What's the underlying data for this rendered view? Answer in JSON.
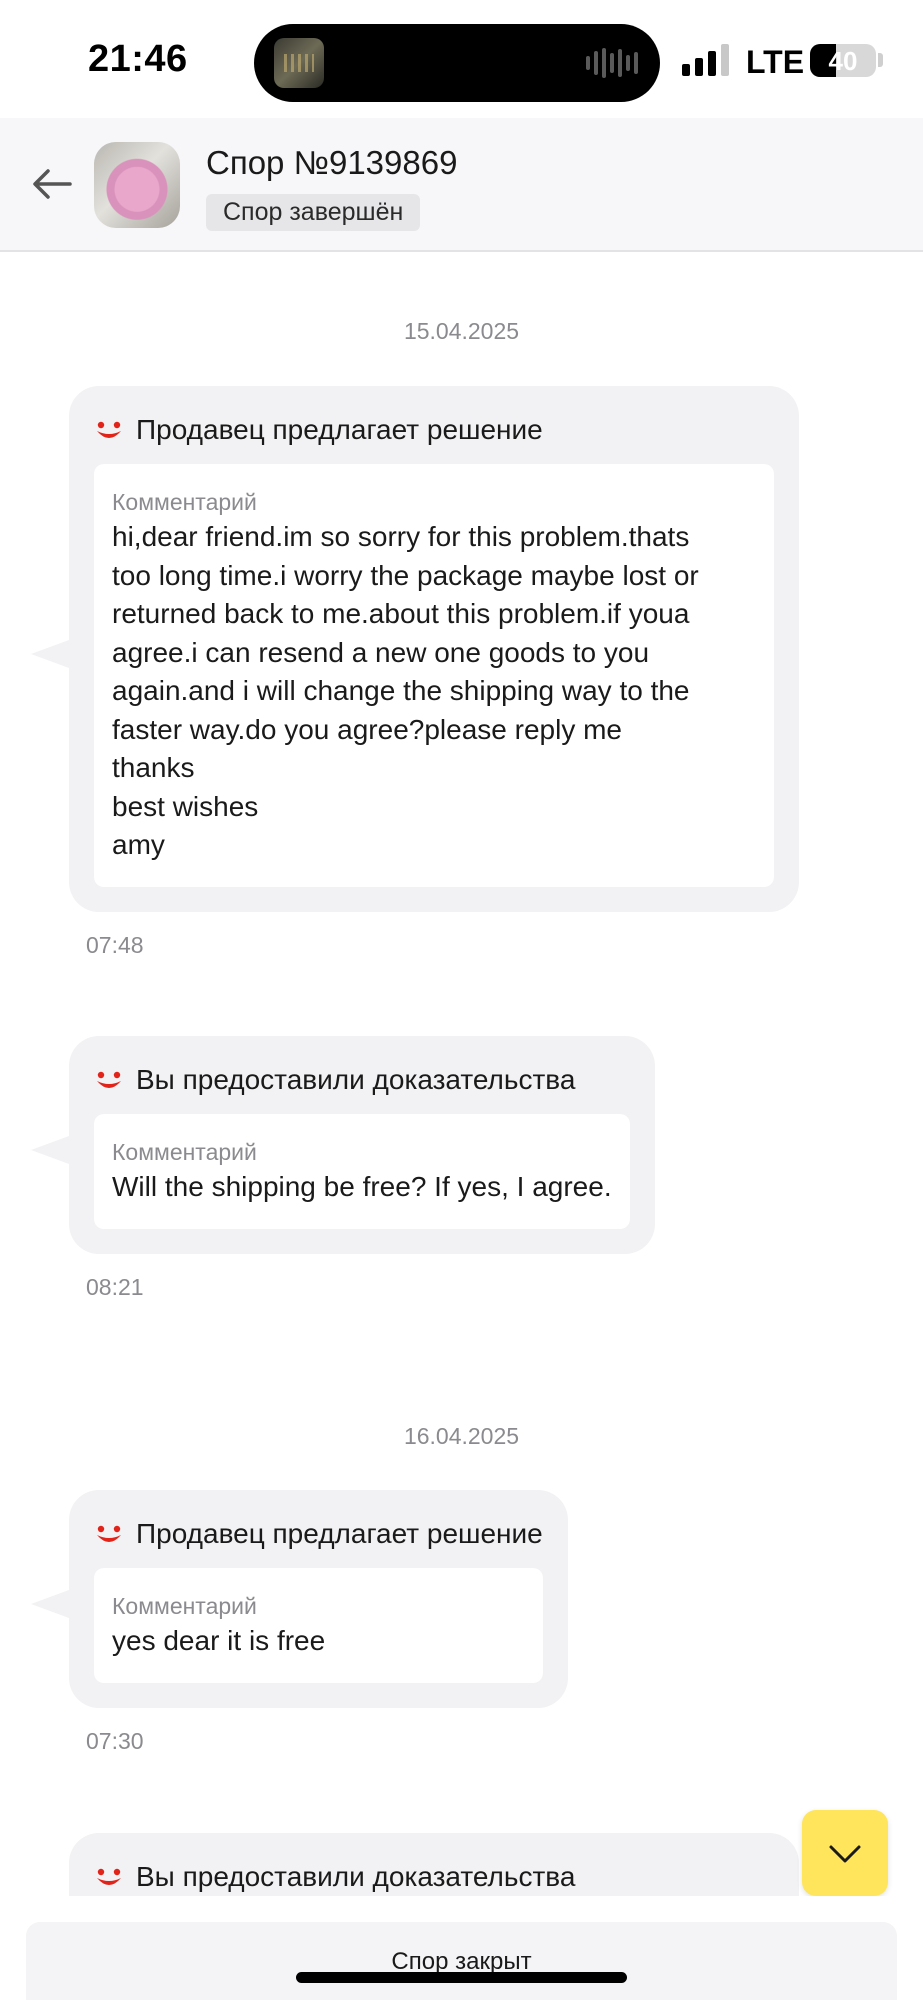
{
  "status_bar": {
    "time": "21:46",
    "network": "LTE",
    "battery": "40",
    "battery_level": 0.4
  },
  "header": {
    "back_icon": "arrow-left-icon",
    "title": "Спор №9139869",
    "status": "Спор завершён"
  },
  "chat": {
    "dates": [
      "15.04.2025",
      "16.04.2025"
    ],
    "messages": [
      {
        "header": "Продавец предлагает решение",
        "comment_label": "Комментарий",
        "text": "hi,dear friend.im so sorry for this problem.thats\ntoo long time.i worry the package maybe lost or\nreturned back to me.about this problem.if youa\nagree.i can resend a new one goods to you\nagain.and i will change the shipping way to the\nfaster way.do you agree?please reply me\nthanks\nbest wishes\namy",
        "time": "07:48"
      },
      {
        "header": "Вы предоставили доказательства",
        "comment_label": "Комментарий",
        "text": "Will the shipping be free? If yes, I agree.",
        "time": "08:21"
      },
      {
        "header": "Продавец предлагает решение",
        "comment_label": "Комментарий",
        "text": "yes dear it is free",
        "time": "07:30"
      },
      {
        "header": "Вы предоставили доказательства"
      }
    ]
  },
  "scroll_down_icon": "chevron-down-icon",
  "footer": {
    "closed_label": "Спор закрыт"
  },
  "colors": {
    "accent_yellow": "#ffe55b",
    "brand_red": "#e2231a",
    "bubble_bg": "#f2f2f4",
    "muted_text": "#8b8b8f"
  }
}
